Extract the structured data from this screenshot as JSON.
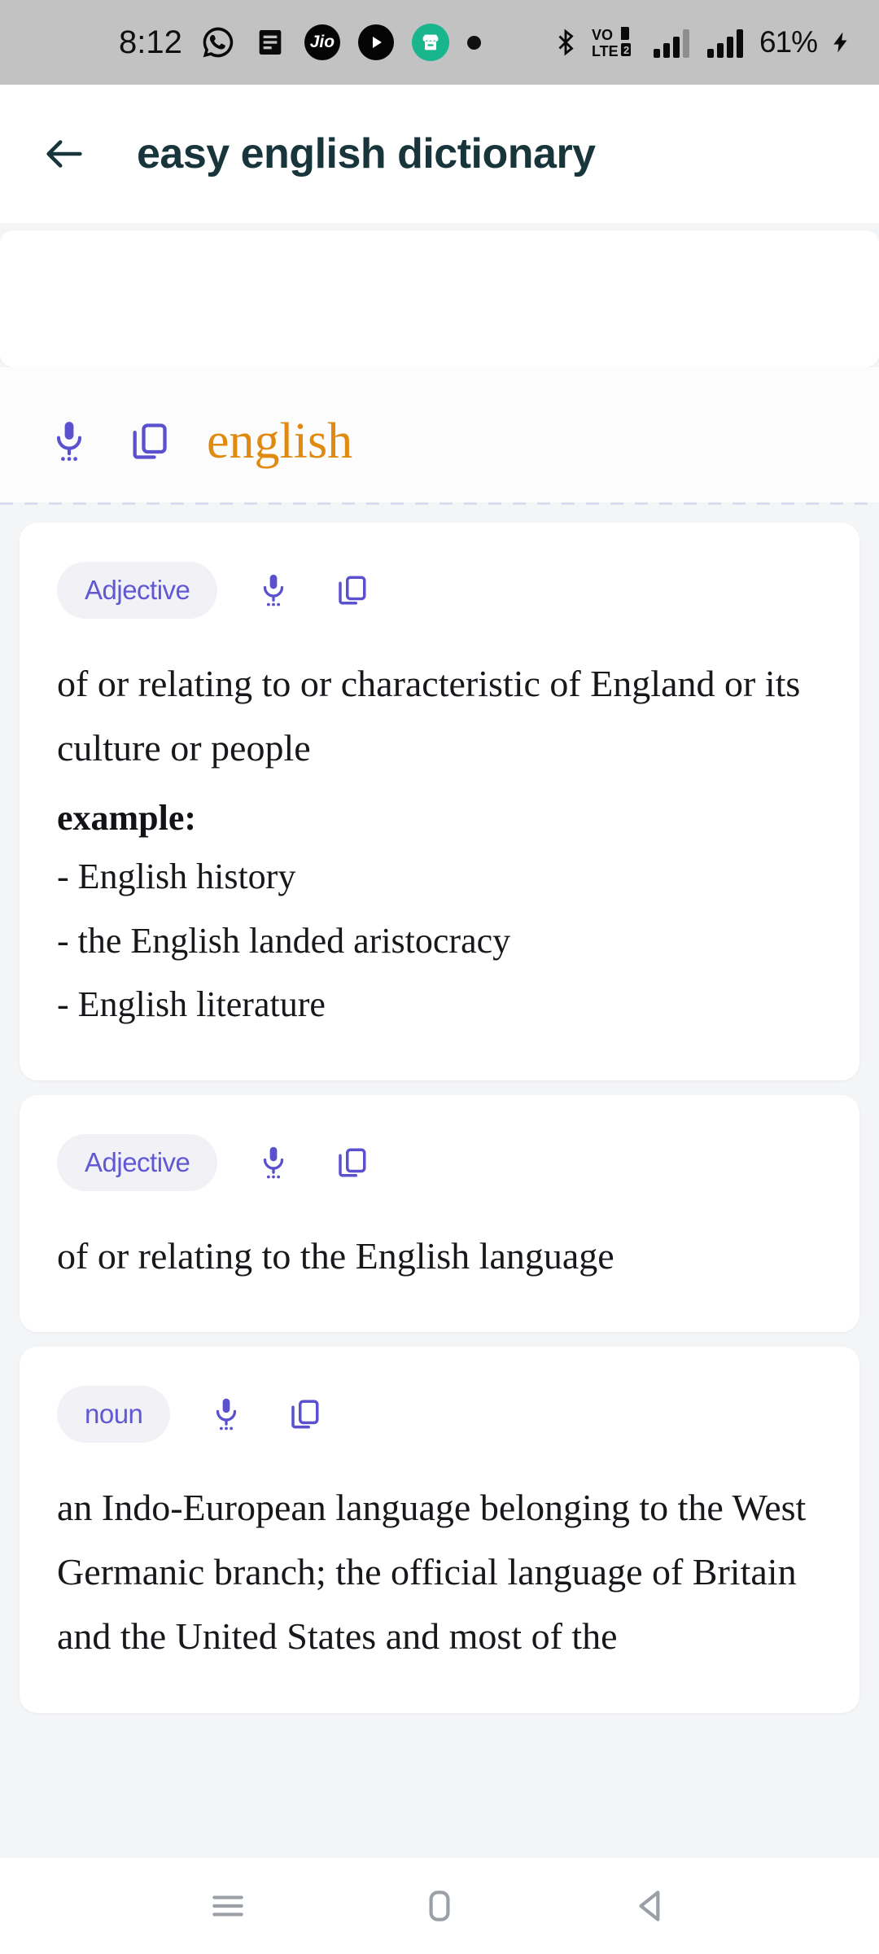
{
  "status_bar": {
    "time": "8:12",
    "battery_percent": "61%",
    "left_icons": [
      "whatsapp-icon",
      "notes-icon",
      "jio-icon",
      "play-icon",
      "store-icon",
      "dot-icon"
    ],
    "right_icons": [
      "bluetooth-icon",
      "volte-icon",
      "signal-bars-1-icon",
      "signal-bars-2-icon",
      "charging-bolt-icon"
    ],
    "jio_label": "Jio",
    "volte_top": "VO",
    "volte_bottom": "LTE",
    "volte_sim": "2",
    "background_color": "#c2c2c2"
  },
  "app_bar": {
    "back_icon": "arrow-left-icon",
    "title": "easy english dictionary",
    "title_color": "#17353b"
  },
  "word_header": {
    "word": "english",
    "word_color": "#e08a10",
    "speak_icon": "microphone-icon",
    "copy_icon": "copy-icon",
    "icon_color": "#5b51cf"
  },
  "accent": {
    "purple": "#6158d4",
    "pill_background": "#f2f2f6",
    "page_background": "#f4f5f7"
  },
  "entries": [
    {
      "part_of_speech": "Adjective",
      "speak_icon": "microphone-icon",
      "copy_icon": "copy-icon",
      "definition": "of or relating to or characteristic of England or its culture or people",
      "example_label": "example:",
      "examples": [
        "- English history",
        "- the English landed aristocracy",
        "- English literature"
      ]
    },
    {
      "part_of_speech": "Adjective",
      "speak_icon": "microphone-icon",
      "copy_icon": "copy-icon",
      "definition": "of or relating to the English language",
      "example_label": "",
      "examples": []
    },
    {
      "part_of_speech": "noun",
      "speak_icon": "microphone-icon",
      "copy_icon": "copy-icon",
      "definition": "an Indo-European language belonging to the West Germanic branch; the official language of Britain and the United States and most of the",
      "example_label": "",
      "examples": []
    }
  ],
  "nav_bar": {
    "recents_icon": "recents-menu-icon",
    "home_icon": "home-icon",
    "back_icon": "back-triangle-icon",
    "icon_color": "#9aa0a6"
  }
}
